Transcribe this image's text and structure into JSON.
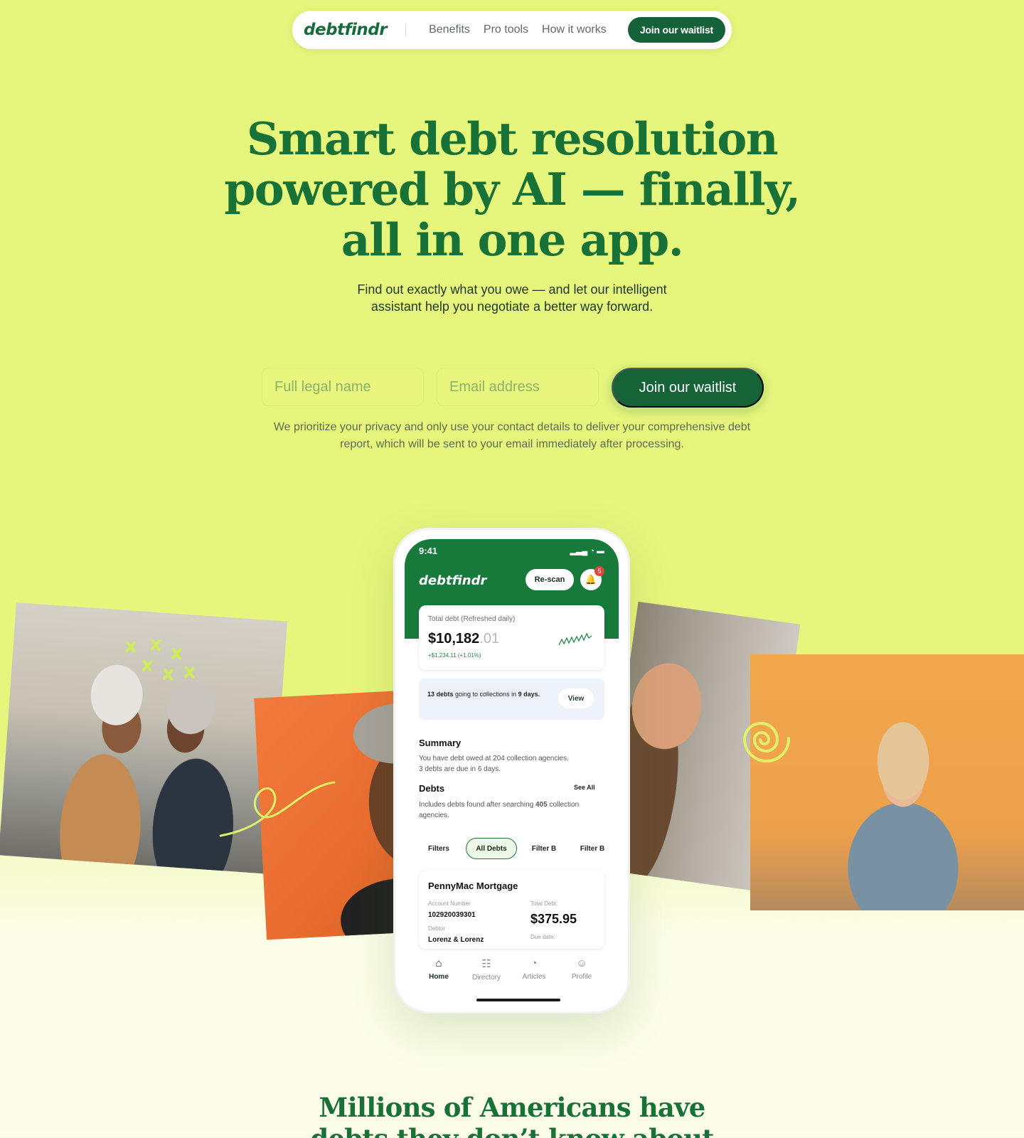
{
  "nav": {
    "logo": "debtfindr",
    "links": [
      "Benefits",
      "Pro tools",
      "How it works"
    ],
    "cta": "Join our waitlist"
  },
  "hero": {
    "title_lines": [
      "Smart debt resolution",
      "powered by AI — finally,",
      "all in one app."
    ],
    "subtitle_lines": [
      "Find out exactly what you owe — and let our intelligent",
      "assistant help you negotiate a better way forward."
    ]
  },
  "form": {
    "name_placeholder": "Full legal name",
    "email_placeholder": "Email address",
    "submit": "Join our waitlist",
    "privacy_lines": [
      "We prioritize your privacy and only use your contact details to deliver your comprehensive debt",
      "report, which will be sent to your email immediately after processing."
    ]
  },
  "phone": {
    "time": "9:41",
    "status_icons": "▂▃▄ ◔ ▬",
    "app_logo": "debtfindr",
    "rescan": "Re-scan",
    "notification_count": "5",
    "total_label": "Total debt (Refreshed daily)",
    "total_amount": "$10,182",
    "total_cents": ".01",
    "total_change": "+$1,234.11 (+1.01%)",
    "alert_bold": "13 debts",
    "alert_text": " going to collections in ",
    "alert_days": "9 days.",
    "alert_button": "View",
    "summary_title": "Summary",
    "summary_lines": [
      "You have debt owed at 204 collection agencies.",
      "3 debts are due in 6 days."
    ],
    "debts_title": "Debts",
    "see_all": "See All",
    "debts_text_pre": "Includes debts found after searching ",
    "debts_text_num": "405",
    "debts_text_post": " collection agencies.",
    "filters": [
      "Filters",
      "All Debts",
      "Filter B",
      "Filter B"
    ],
    "mortgage": {
      "name": "PennyMac Mortgage",
      "account_label": "Account Number",
      "account_number": "102920039301",
      "debtor_label": "Debtor",
      "debtor": "Lorenz & Lorenz",
      "total_label": "Total Debt:",
      "total": "$375.95",
      "due_label": "Due date:"
    },
    "tabs": [
      {
        "label": "Home",
        "icon": "home-icon"
      },
      {
        "label": "Directory",
        "icon": "building-icon"
      },
      {
        "label": "Articles",
        "icon": "pie-icon"
      },
      {
        "label": "Profile",
        "icon": "person-icon"
      }
    ]
  },
  "bottom": {
    "title_lines": [
      "Millions of Americans have",
      "debts they don’t know about"
    ]
  },
  "colors": {
    "brand_green": "#176338",
    "background_lime": "#e6f57c",
    "accent_orange": "#ef7a3a"
  }
}
